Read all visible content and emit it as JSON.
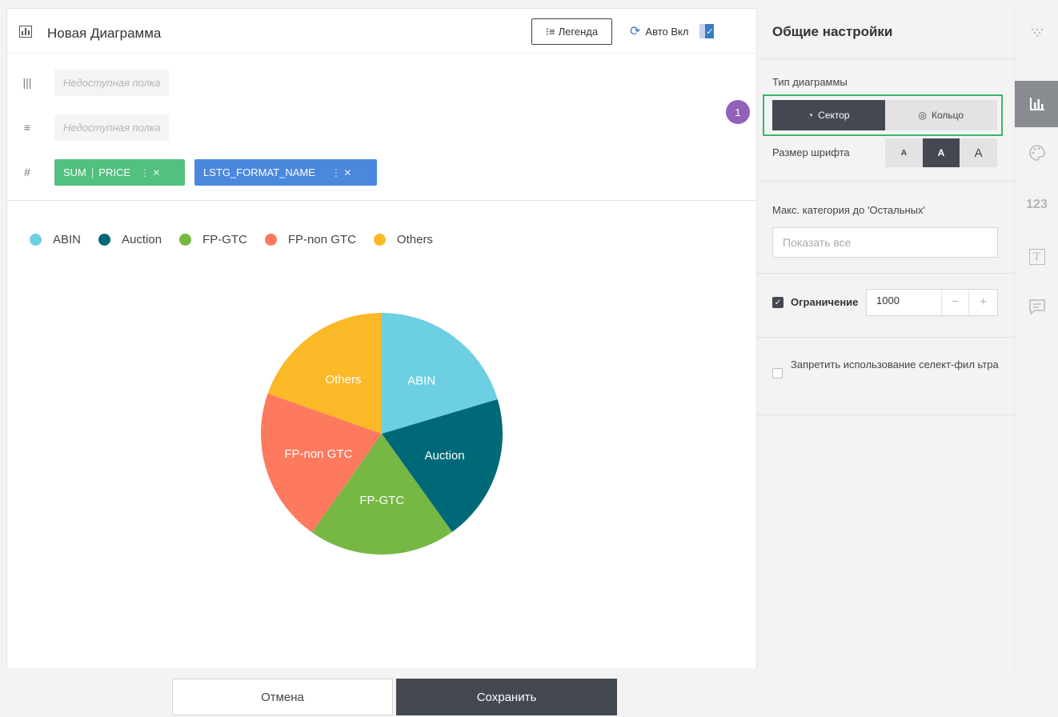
{
  "header": {
    "title": "Новая Диаграмма",
    "legend_label": "Легенда",
    "auto_label": "Авто Вкл"
  },
  "shelves": {
    "row1_placeholder": "Недоступная полка",
    "row2_placeholder": "Недоступная полка",
    "pill_measure": {
      "agg": "SUM",
      "field": "PRICE"
    },
    "pill_dimension": {
      "field": "LSTG_FORMAT_NAME"
    }
  },
  "chart_data": {
    "type": "pie",
    "categories": [
      "ABIN",
      "Auction",
      "FP-GTC",
      "FP-non GTC",
      "Others"
    ],
    "values": [
      20.4,
      19.7,
      19.7,
      20.6,
      19.6
    ],
    "colors": [
      "#6dd0e2",
      "#006978",
      "#76b843",
      "#fd7a5f",
      "#fbb827"
    ],
    "legend_placement": "top-left"
  },
  "footer": {
    "cancel": "Отмена",
    "save": "Сохранить"
  },
  "settings": {
    "title": "Общие настройки",
    "chart_type_label": "Тип диаграммы",
    "chart_type_options": [
      "Сектор",
      "Кольцо"
    ],
    "selected_chart_type": "Сектор",
    "font_size_label": "Размер шрифта",
    "font_size_options": [
      "A",
      "A",
      "A"
    ],
    "max_category_label": "Макс. категория до 'Остальных'",
    "max_category_placeholder": "Показать все",
    "limit_label": "Ограничение",
    "limit_value": "1000",
    "deny_select_filter_label": "Запретить использование селект-фил ьтра"
  },
  "marker": "1",
  "rail": {
    "number_icon": "123",
    "text_icon": "T"
  },
  "colors": {
    "accent_dark": "#444850",
    "highlight": "#3bb56a",
    "marker": "#9260b8"
  }
}
